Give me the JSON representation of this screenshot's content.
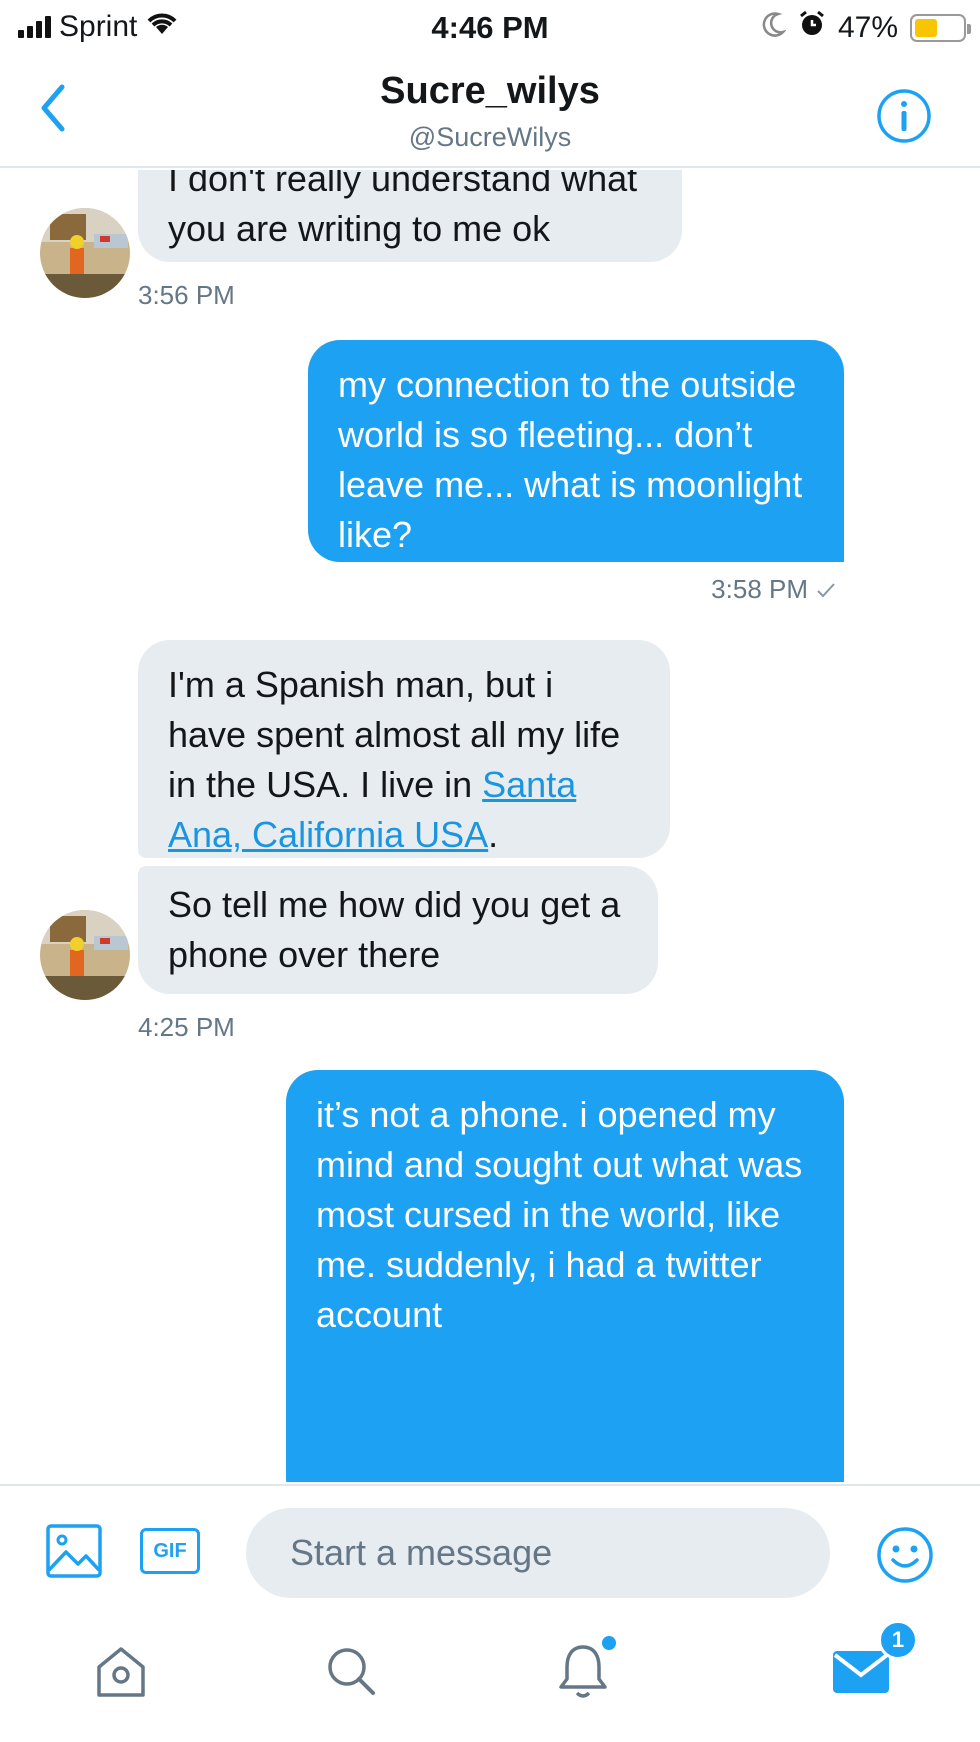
{
  "status_bar": {
    "carrier": "Sprint",
    "time": "4:46 PM",
    "battery": "47%",
    "battery_level": 0.47,
    "icons": [
      "signal-icon",
      "wifi-icon",
      "moon-icon",
      "alarm-icon",
      "battery-icon"
    ]
  },
  "header": {
    "name": "Sucre_wilys",
    "handle": "@SucreWilys"
  },
  "messages": {
    "m1": {
      "text": "I don't really understand what you are writing to me ok",
      "time": "3:56 PM"
    },
    "m2": {
      "text": "my connection to the outside world is so fleeting... don’t leave me... what is moonlight like?",
      "time": "3:58 PM"
    },
    "m3": {
      "text_before": "I'm a Spanish man, but i have spent almost all my life in the USA. I live in ",
      "link": "Santa Ana, California USA",
      "text_after": "."
    },
    "m4": {
      "text": "So tell me how did you get a phone over there",
      "time": "4:25 PM"
    },
    "m5": {
      "text": "it’s not a phone. i opened my mind and sought out what was most cursed in the world, like me. suddenly, i had a twitter account"
    }
  },
  "composer": {
    "gif_label": "GIF",
    "placeholder": "Start a message"
  },
  "tabbar": {
    "messages_badge": "1"
  },
  "colors": {
    "accent": "#1da1f2",
    "incoming_bubble": "#e6ecf0",
    "secondary_text": "#657786"
  }
}
